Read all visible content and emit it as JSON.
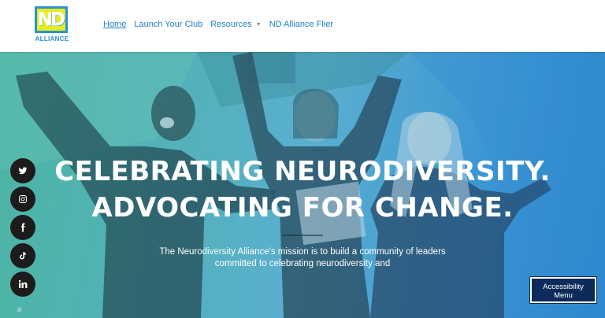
{
  "logo": {
    "letters": "ND",
    "word": "ALLIANCE"
  },
  "nav": {
    "home": "Home",
    "launch": "Launch Your Club",
    "resources": "Resources",
    "flier": "ND Alliance Flier"
  },
  "hero": {
    "line1": "CELEBRATING NEURODIVERSITY.",
    "line2": "ADVOCATING FOR CHANGE.",
    "mission": "The Neurodiversity Alliance's mission is to build a community of leaders committed to celebrating neurodiversity and"
  },
  "social": {
    "twitter": "twitter-icon",
    "instagram": "instagram-icon",
    "facebook": "facebook-icon",
    "tiktok": "tiktok-icon",
    "linkedin": "linkedin-icon"
  },
  "accessibility": {
    "label_line1": "Accessibility",
    "label_line2": "Menu"
  },
  "colors": {
    "brand_blue": "#2d8fd6",
    "brand_yellow": "#e6ed1c",
    "nav_link": "#1f7fc4",
    "access_bg": "#0d2b5a"
  }
}
